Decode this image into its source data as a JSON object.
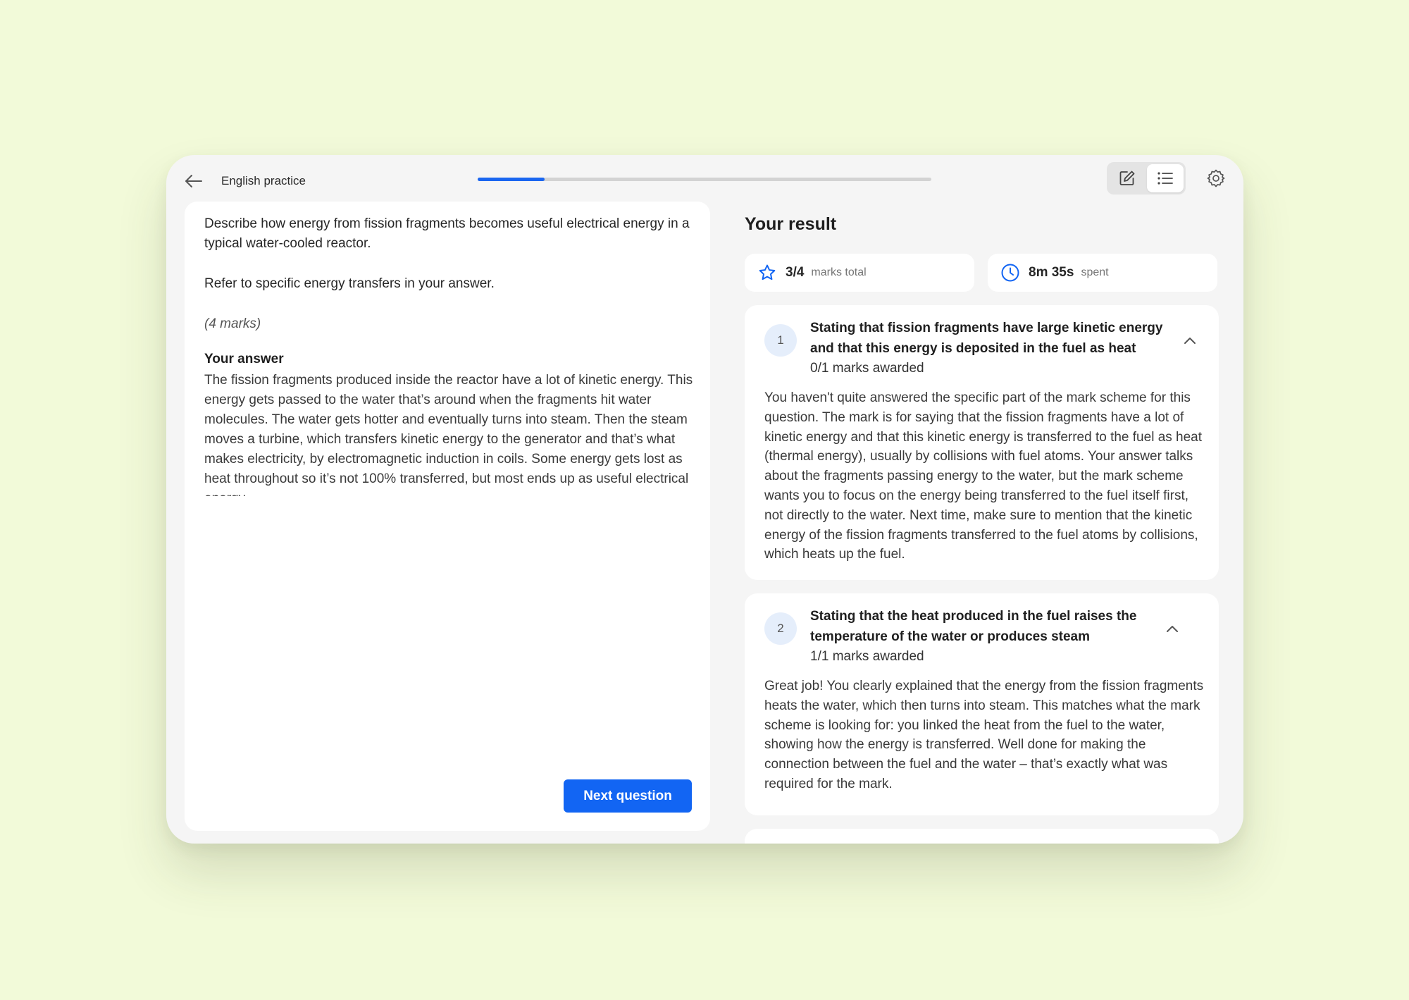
{
  "header": {
    "title": "English practice",
    "progress_fraction": 0.147
  },
  "question": {
    "line1": "Describe how energy from fission fragments becomes useful electrical energy in a typical water-cooled reactor.",
    "line2": "Refer to specific energy transfers in your answer.",
    "marks": "(4 marks)",
    "answer_label": "Your answer",
    "answer_text": "The fission fragments produced inside the reactor have a lot of kinetic energy. This energy gets passed to the water that’s around when the fragments hit water molecules. The water gets hotter and eventually turns into steam. Then the steam moves a turbine, which transfers kinetic energy to the generator and that’s what makes electricity, by electromagnetic induction in coils. Some energy gets lost as heat throughout so it’s not 100% transferred, but most ends up as useful electrical energy.",
    "next_button": "Next question"
  },
  "result": {
    "title": "Your result",
    "marks_value": "3/4",
    "marks_unit": "marks total",
    "time_value": "8m 35s",
    "time_unit": "spent",
    "criteria": [
      {
        "number": "1",
        "title": "Stating that fission fragments have large kinetic energy and that this energy is deposited in the fuel as heat",
        "awarded": "0/1 marks awarded",
        "feedback": "You haven't quite answered the specific part of the mark scheme for this question. The mark is for saying that the fission fragments have a lot of kinetic energy and that this kinetic energy is transferred to the fuel as heat (thermal energy), usually by collisions with fuel atoms. Your answer talks about the fragments passing energy to the water, but the mark scheme wants you to focus on the energy being transferred to the fuel itself first, not directly to the water. Next time, make sure to mention that the kinetic energy of the fission fragments transferred to the fuel atoms by collisions, which heats up the fuel."
      },
      {
        "number": "2",
        "title": "Stating that the heat produced in the fuel raises the temperature of the water or produces steam",
        "awarded": "1/1 marks awarded",
        "feedback": "Great job! You clearly explained that the energy from the fission fragments heats the water, which then turns into steam. This matches what the mark scheme is looking for: you linked the heat from the fuel to the water, showing how the energy is transferred. Well done for making the connection between the fuel and the water – that’s exactly what was required for the mark."
      }
    ]
  },
  "colors": {
    "accent": "#1265f3",
    "background": "#f2fad9"
  },
  "icons": {
    "back": "arrow-left-icon",
    "edit": "edit-icon",
    "list": "list-icon",
    "settings": "gear-icon",
    "marks": "star-icon",
    "time": "clock-icon",
    "collapse": "chevron-up-icon"
  }
}
